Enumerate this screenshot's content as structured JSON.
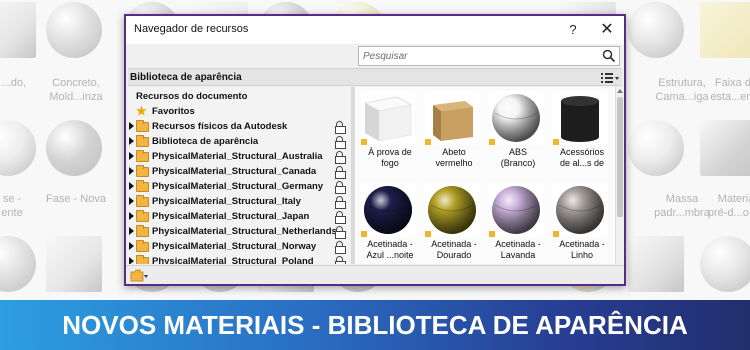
{
  "background": {
    "captions": [
      {
        "text": "...do,",
        "line2": ""
      },
      {
        "text": "Concreto,",
        "line2": "Mold...inza"
      },
      {
        "text": "Estrutura,",
        "line2": "Cama...iga"
      },
      {
        "text": "Faixa de",
        "line2": "esta...ento"
      },
      {
        "text": "se -",
        "line2": "ente"
      },
      {
        "text": "Fase - Nova",
        "line2": ""
      },
      {
        "text": "Massa",
        "line2": "padr...mbra"
      },
      {
        "text": "Materia",
        "line2": "pré-d...o de"
      }
    ]
  },
  "dialog": {
    "title": "Navegador de recursos",
    "help_label": "?",
    "close_label": "✕",
    "search_placeholder": "Pesquisar",
    "library_header": "Biblioteca de aparência"
  },
  "tree": {
    "items": [
      {
        "label": "Recursos do documento",
        "type": "plain"
      },
      {
        "label": "Favoritos",
        "type": "star"
      },
      {
        "label": "Recursos físicos da Autodesk",
        "type": "folder",
        "locked": true
      },
      {
        "label": "Biblioteca de aparência",
        "type": "folder",
        "locked": true
      },
      {
        "label": "PhysicalMaterial_Structural_Australia",
        "type": "folder",
        "locked": true
      },
      {
        "label": "PhysicalMaterial_Structural_Canada",
        "type": "folder",
        "locked": true
      },
      {
        "label": "PhysicalMaterial_Structural_Germany",
        "type": "folder",
        "locked": true
      },
      {
        "label": "PhysicalMaterial_Structural_Italy",
        "type": "folder",
        "locked": true
      },
      {
        "label": "PhysicalMaterial_Structural_Japan",
        "type": "folder",
        "locked": true
      },
      {
        "label": "PhysicalMaterial_Structural_Netherlands",
        "type": "folder",
        "locked": true
      },
      {
        "label": "PhysicalMaterial_Structural_Norway",
        "type": "folder",
        "locked": true
      },
      {
        "label": "PhysicalMaterial_Structural_Poland",
        "type": "folder",
        "locked": true
      }
    ]
  },
  "materials": [
    {
      "line1": "À prova de",
      "line2": "fogo",
      "color": "#f2f2f2",
      "kind": "panel"
    },
    {
      "line1": "Abeto",
      "line2": "vermelho",
      "color": "#c9a062",
      "kind": "cube"
    },
    {
      "line1": "ABS",
      "line2": "(Branco)",
      "color": "#f4f4f4",
      "kind": "sphere"
    },
    {
      "line1": "Acessórios",
      "line2": "de al...s de",
      "color": "#1d1d1d",
      "kind": "cylinder"
    },
    {
      "line1": "Acetinada -",
      "line2": "Azul ...noite",
      "color": "#1c1f4a",
      "kind": "sphere"
    },
    {
      "line1": "Acetinada -",
      "line2": "Dourado",
      "color": "#b3a227",
      "kind": "sphere"
    },
    {
      "line1": "Acetinada -",
      "line2": "Lavanda",
      "color": "#c8b0d8",
      "kind": "sphere"
    },
    {
      "line1": "Acetinada -",
      "line2": "Linho",
      "color": "#a7a19d",
      "kind": "sphere"
    }
  ],
  "banner": {
    "text": "NOVOS MATERIAIS - BIBLIOTECA DE APARÊNCIA"
  }
}
